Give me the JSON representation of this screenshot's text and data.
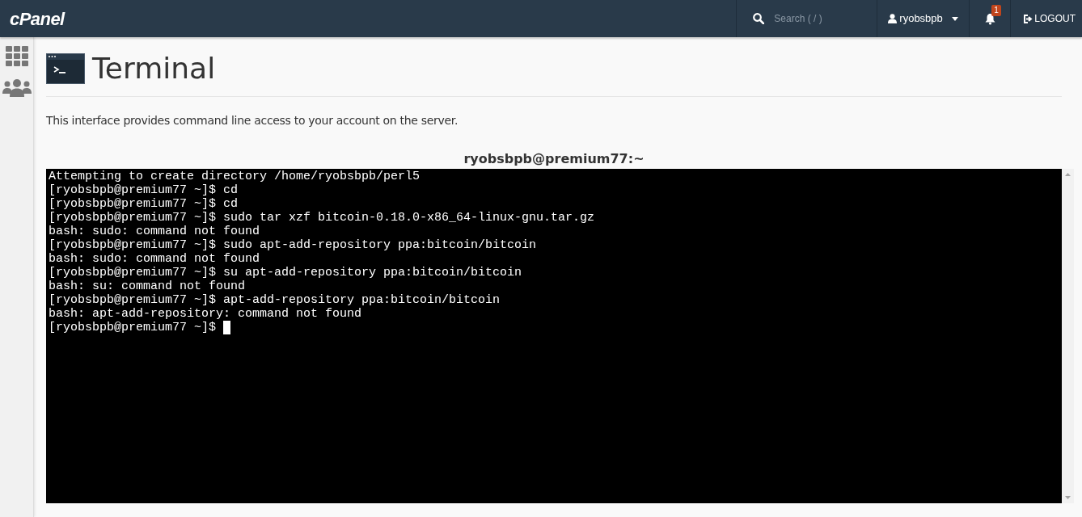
{
  "header": {
    "logo": "cPanel",
    "search": {
      "placeholder": "Search ( / )"
    },
    "user": "ryobsbpb",
    "notifications": {
      "count": "1"
    },
    "logout": "LOGOUT"
  },
  "page": {
    "title": "Terminal",
    "description": "This interface provides command line access to your account on the server."
  },
  "terminal": {
    "title": "ryobsbpb@premium77:~",
    "cursor": true,
    "lines": [
      "Attempting to create directory /home/ryobsbpb/perl5",
      "[ryobsbpb@premium77 ~]$ cd",
      "[ryobsbpb@premium77 ~]$ cd",
      "[ryobsbpb@premium77 ~]$ sudo tar xzf bitcoin-0.18.0-x86_64-linux-gnu.tar.gz",
      "bash: sudo: command not found",
      "[ryobsbpb@premium77 ~]$ sudo apt-add-repository ppa:bitcoin/bitcoin",
      "bash: sudo: command not found",
      "[ryobsbpb@premium77 ~]$ su apt-add-repository ppa:bitcoin/bitcoin",
      "bash: su: command not found",
      "[ryobsbpb@premium77 ~]$ apt-add-repository ppa:bitcoin/bitcoin",
      "bash: apt-add-repository: command not found",
      "[ryobsbpb@premium77 ~]$ "
    ]
  }
}
